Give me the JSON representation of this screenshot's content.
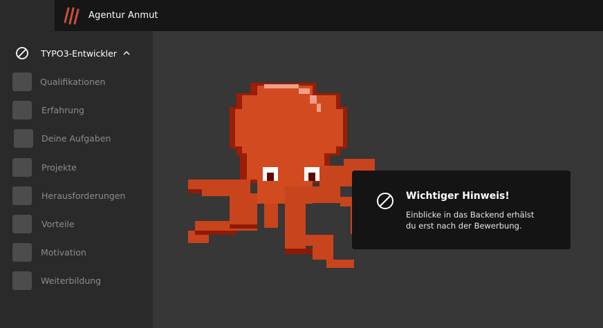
{
  "header": {
    "title": "Agentur Anmut",
    "logo_icon": "triple-slash-logo",
    "accent_color": "#c8503a"
  },
  "sidebar": {
    "section": {
      "label": "TYPO3-Entwickler",
      "icon": "ban-icon",
      "expanded": true
    },
    "items": [
      {
        "label": "Qualifikationen"
      },
      {
        "label": "Erfahrung"
      },
      {
        "label": "Deine Aufgaben"
      },
      {
        "label": "Projekte"
      },
      {
        "label": "Herausforderungen"
      },
      {
        "label": "Vorteile"
      },
      {
        "label": "Motivation"
      },
      {
        "label": "Weiterbildung"
      }
    ]
  },
  "main": {
    "illustration": "pixel-octopus"
  },
  "notice": {
    "title": "Wichtiger Hinweis!",
    "line1": "Einblicke in das Backend erhälst",
    "line2": "du erst nach der Bewerbung."
  }
}
